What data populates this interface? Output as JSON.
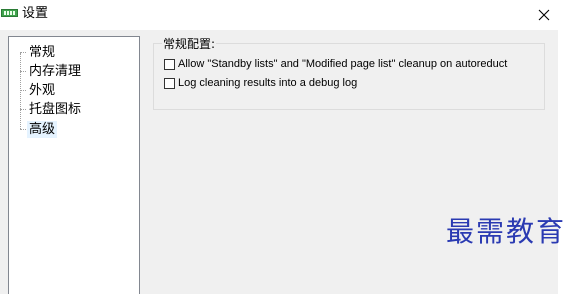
{
  "window": {
    "title": "设置",
    "app_icon": "memory-chip-icon",
    "close_icon": "close-icon"
  },
  "sidebar": {
    "items": [
      {
        "label": "常规",
        "selected": false
      },
      {
        "label": "内存清理",
        "selected": false
      },
      {
        "label": "外观",
        "selected": false
      },
      {
        "label": "托盘图标",
        "selected": false
      },
      {
        "label": "高级",
        "selected": true
      }
    ]
  },
  "general_settings": {
    "group_title": "常规配置:",
    "options": [
      {
        "label": "Allow \"Standby lists\" and \"Modified page list\" cleanup on autoreduct",
        "checked": false
      },
      {
        "label": "Log cleaning results into a debug log",
        "checked": false
      }
    ]
  },
  "watermark": {
    "text": "最需教育"
  },
  "colors": {
    "selection": "#e5f3ff",
    "client_bg": "#f0f0f0",
    "tree_border": "#828790",
    "watermark": "#2a3ab2"
  }
}
